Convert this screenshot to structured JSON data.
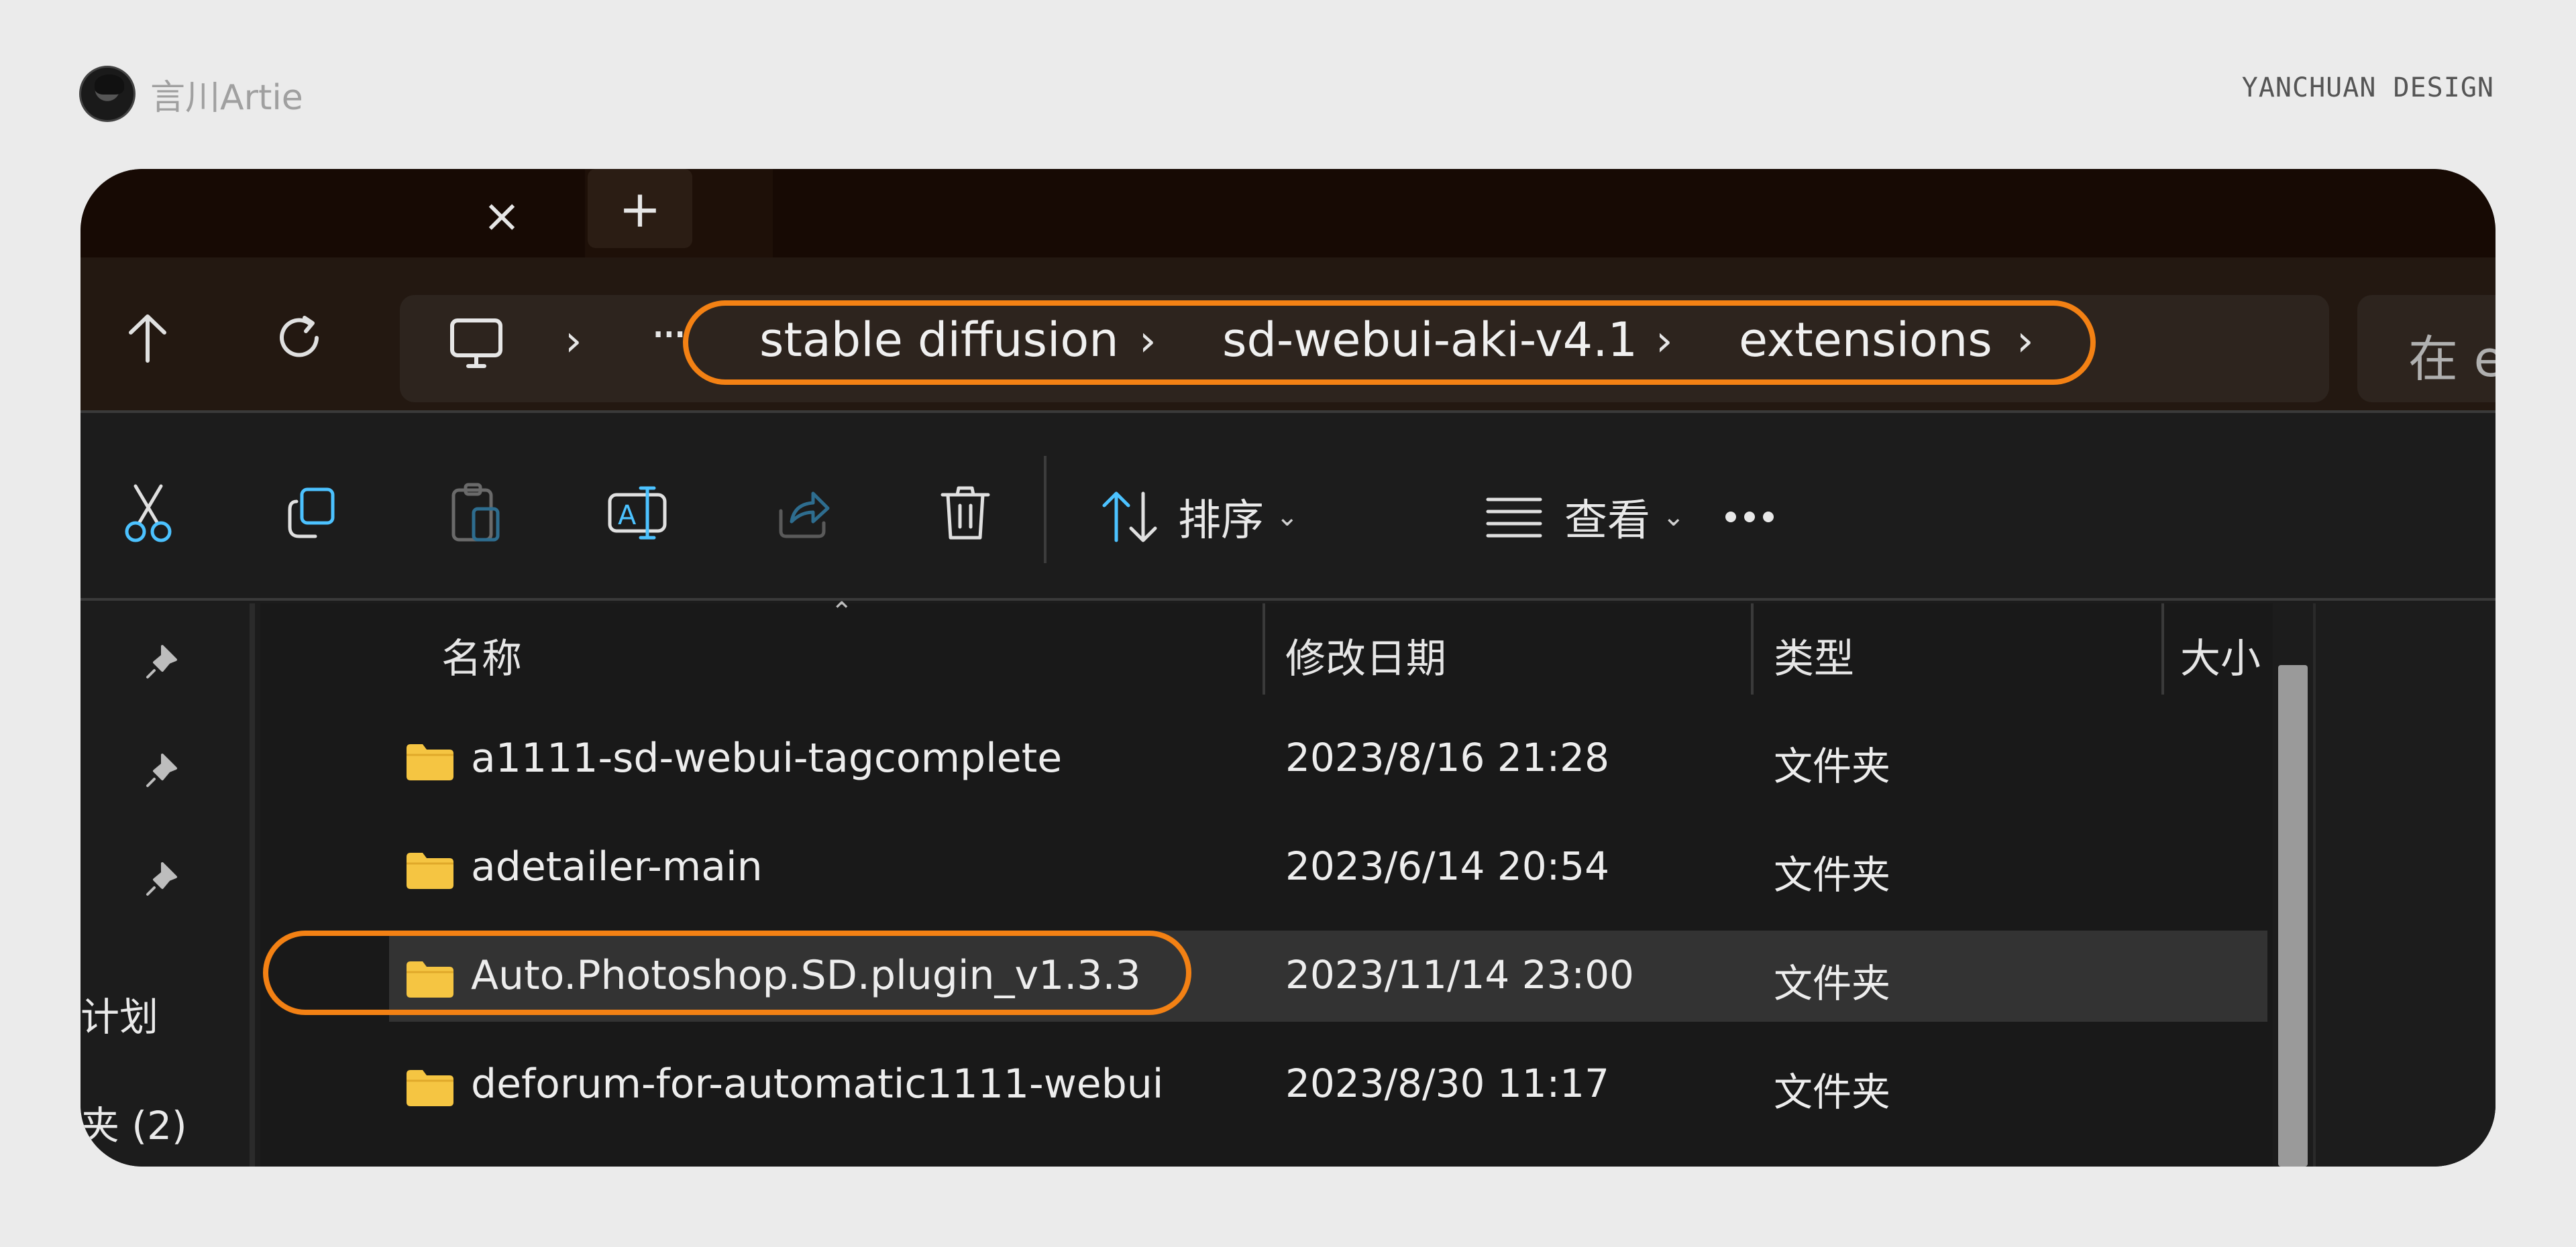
{
  "author": {
    "name": "言川Artie"
  },
  "brand": "YANCHUAN DESIGN",
  "tabs": {
    "close_label": "×",
    "new_label": "+"
  },
  "address": {
    "crumbs": [
      "stable diffusion",
      "sd-webui-aki-v4.1",
      "extensions"
    ],
    "ellipsis": "···",
    "chevron": "›",
    "search_placeholder": "在 e"
  },
  "toolbar": {
    "sort_label": "排序",
    "view_label": "查看",
    "caret": "⌄"
  },
  "sidebar": {
    "items": [
      "计划",
      "夹 (2)"
    ]
  },
  "columns": {
    "name": "名称",
    "modified": "修改日期",
    "type": "类型",
    "size": "大小"
  },
  "rows": [
    {
      "name": "a1111-sd-webui-tagcomplete",
      "modified": "2023/8/16 21:28",
      "type": "文件夹"
    },
    {
      "name": "adetailer-main",
      "modified": "2023/6/14 20:54",
      "type": "文件夹"
    },
    {
      "name": "Auto.Photoshop.SD.plugin_v1.3.3",
      "modified": "2023/11/14 23:00",
      "type": "文件夹",
      "selected": true
    },
    {
      "name": "deforum-for-automatic1111-webui",
      "modified": "2023/8/30 11:17",
      "type": "文件夹"
    }
  ],
  "colors": {
    "highlight": "#f38114",
    "accent_icon": "#4cc2ff",
    "folder": "#f5c542"
  }
}
